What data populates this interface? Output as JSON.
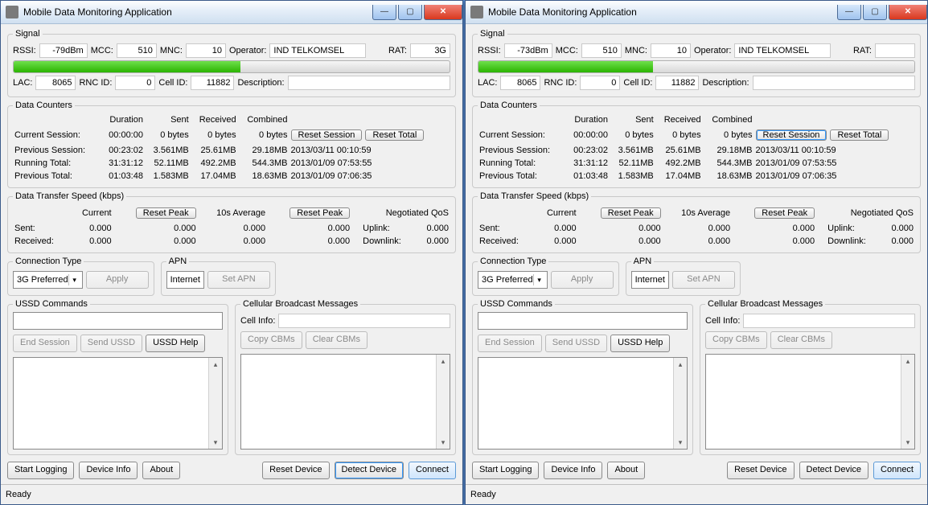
{
  "windows": [
    {
      "title": "Mobile Data Monitoring Application",
      "signal": {
        "legend": "Signal",
        "rssi_label": "RSSI:",
        "rssi": "-79dBm",
        "mcc_label": "MCC:",
        "mcc": "510",
        "mnc_label": "MNC:",
        "mnc": "10",
        "operator_label": "Operator:",
        "operator": "IND TELKOMSEL",
        "rat_label": "RAT:",
        "rat": "3G",
        "bar_pct": 52,
        "lac_label": "LAC:",
        "lac": "8065",
        "rncid_label": "RNC ID:",
        "rncid": "0",
        "cellid_label": "Cell ID:",
        "cellid": "11882",
        "desc_label": "Description:",
        "desc": ""
      },
      "counters": {
        "legend": "Data Counters",
        "hdr_duration": "Duration",
        "hdr_sent": "Sent",
        "hdr_recv": "Received",
        "hdr_comb": "Combined",
        "reset_session": "Reset Session",
        "reset_total": "Reset Total",
        "rows": [
          {
            "l": "Current Session:",
            "d": "00:00:00",
            "s": "0 bytes",
            "r": "0 bytes",
            "c": "0 bytes",
            "t": ""
          },
          {
            "l": "Previous Session:",
            "d": "00:23:02",
            "s": "3.561MB",
            "r": "25.61MB",
            "c": "29.18MB",
            "t": "2013/03/11 00:10:59"
          },
          {
            "l": "Running Total:",
            "d": "31:31:12",
            "s": "52.11MB",
            "r": "492.2MB",
            "c": "544.3MB",
            "t": "2013/01/09 07:53:55"
          },
          {
            "l": "Previous Total:",
            "d": "01:03:48",
            "s": "1.583MB",
            "r": "17.04MB",
            "c": "18.63MB",
            "t": "2013/01/09 07:06:35"
          }
        ]
      },
      "speed": {
        "legend": "Data Transfer Speed (kbps)",
        "current": "Current",
        "avg": "10s Average",
        "reset_peak": "Reset Peak",
        "qos": "Negotiated QoS",
        "uplink": "Uplink:",
        "downlink": "Downlink:",
        "sent_label": "Sent:",
        "recv_label": "Received:",
        "sent": [
          "0.000",
          "0.000",
          "0.000",
          "0.000"
        ],
        "recv": [
          "0.000",
          "0.000",
          "0.000",
          "0.000"
        ],
        "qos_up": "0.000",
        "qos_dn": "0.000"
      },
      "conn": {
        "legend": "Connection Type",
        "value": "3G Preferred",
        "apply": "Apply"
      },
      "apn": {
        "legend": "APN",
        "value": "Internet",
        "set": "Set APN"
      },
      "ussd": {
        "legend": "USSD Commands",
        "end": "End Session",
        "send": "Send USSD",
        "help": "USSD Help"
      },
      "cbm": {
        "legend": "Cellular Broadcast Messages",
        "cellinfo": "Cell Info:",
        "copy": "Copy CBMs",
        "clear": "Clear CBMs"
      },
      "footer": {
        "start": "Start Logging",
        "devinfo": "Device Info",
        "about": "About",
        "reset": "Reset Device",
        "detect": "Detect Device",
        "connect": "Connect"
      },
      "status": "Ready",
      "focus_btn": "detect"
    },
    {
      "title": "Mobile Data Monitoring Application",
      "signal": {
        "legend": "Signal",
        "rssi_label": "RSSI:",
        "rssi": "-73dBm",
        "mcc_label": "MCC:",
        "mcc": "510",
        "mnc_label": "MNC:",
        "mnc": "10",
        "operator_label": "Operator:",
        "operator": "IND TELKOMSEL",
        "rat_label": "RAT:",
        "rat": "",
        "bar_pct": 40,
        "lac_label": "LAC:",
        "lac": "8065",
        "rncid_label": "RNC ID:",
        "rncid": "0",
        "cellid_label": "Cell ID:",
        "cellid": "11882",
        "desc_label": "Description:",
        "desc": ""
      },
      "counters": {
        "legend": "Data Counters",
        "hdr_duration": "Duration",
        "hdr_sent": "Sent",
        "hdr_recv": "Received",
        "hdr_comb": "Combined",
        "reset_session": "Reset Session",
        "reset_total": "Reset Total",
        "rows": [
          {
            "l": "Current Session:",
            "d": "00:00:00",
            "s": "0 bytes",
            "r": "0 bytes",
            "c": "0 bytes",
            "t": ""
          },
          {
            "l": "Previous Session:",
            "d": "00:23:02",
            "s": "3.561MB",
            "r": "25.61MB",
            "c": "29.18MB",
            "t": "2013/03/11 00:10:59"
          },
          {
            "l": "Running Total:",
            "d": "31:31:12",
            "s": "52.11MB",
            "r": "492.2MB",
            "c": "544.3MB",
            "t": "2013/01/09 07:53:55"
          },
          {
            "l": "Previous Total:",
            "d": "01:03:48",
            "s": "1.583MB",
            "r": "17.04MB",
            "c": "18.63MB",
            "t": "2013/01/09 07:06:35"
          }
        ]
      },
      "speed": {
        "legend": "Data Transfer Speed (kbps)",
        "current": "Current",
        "avg": "10s Average",
        "reset_peak": "Reset Peak",
        "qos": "Negotiated QoS",
        "uplink": "Uplink:",
        "downlink": "Downlink:",
        "sent_label": "Sent:",
        "recv_label": "Received:",
        "sent": [
          "0.000",
          "0.000",
          "0.000",
          "0.000"
        ],
        "recv": [
          "0.000",
          "0.000",
          "0.000",
          "0.000"
        ],
        "qos_up": "0.000",
        "qos_dn": "0.000"
      },
      "conn": {
        "legend": "Connection Type",
        "value": "3G Preferred",
        "apply": "Apply"
      },
      "apn": {
        "legend": "APN",
        "value": "Internet",
        "set": "Set APN"
      },
      "ussd": {
        "legend": "USSD Commands",
        "end": "End Session",
        "send": "Send USSD",
        "help": "USSD Help"
      },
      "cbm": {
        "legend": "Cellular Broadcast Messages",
        "cellinfo": "Cell Info:",
        "copy": "Copy CBMs",
        "clear": "Clear CBMs"
      },
      "footer": {
        "start": "Start Logging",
        "devinfo": "Device Info",
        "about": "About",
        "reset": "Reset Device",
        "detect": "Detect Device",
        "connect": "Connect"
      },
      "status": "Ready",
      "focus_btn": "reset_session"
    }
  ]
}
